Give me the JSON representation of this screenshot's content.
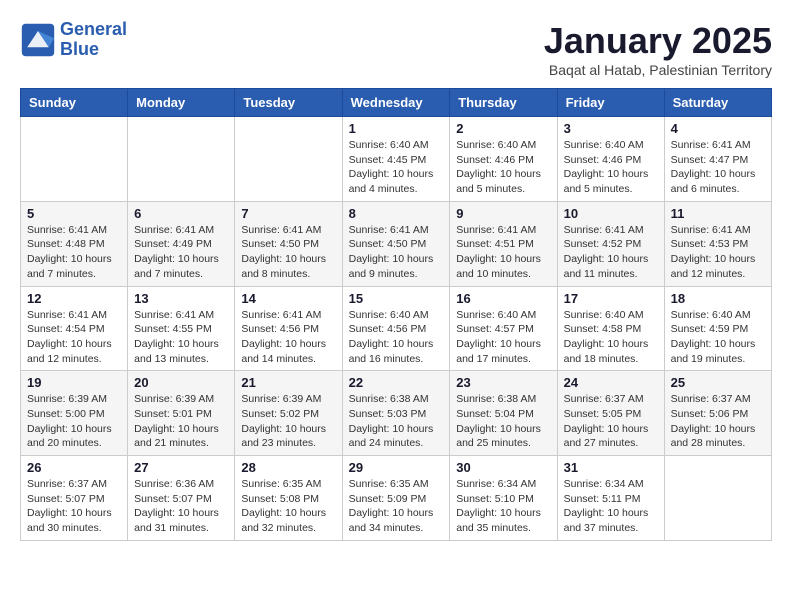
{
  "logo": {
    "line1": "General",
    "line2": "Blue"
  },
  "title": "January 2025",
  "location": "Baqat al Hatab, Palestinian Territory",
  "weekdays": [
    "Sunday",
    "Monday",
    "Tuesday",
    "Wednesday",
    "Thursday",
    "Friday",
    "Saturday"
  ],
  "weeks": [
    [
      {
        "day": "",
        "info": ""
      },
      {
        "day": "",
        "info": ""
      },
      {
        "day": "",
        "info": ""
      },
      {
        "day": "1",
        "info": "Sunrise: 6:40 AM\nSunset: 4:45 PM\nDaylight: 10 hours\nand 4 minutes."
      },
      {
        "day": "2",
        "info": "Sunrise: 6:40 AM\nSunset: 4:46 PM\nDaylight: 10 hours\nand 5 minutes."
      },
      {
        "day": "3",
        "info": "Sunrise: 6:40 AM\nSunset: 4:46 PM\nDaylight: 10 hours\nand 5 minutes."
      },
      {
        "day": "4",
        "info": "Sunrise: 6:41 AM\nSunset: 4:47 PM\nDaylight: 10 hours\nand 6 minutes."
      }
    ],
    [
      {
        "day": "5",
        "info": "Sunrise: 6:41 AM\nSunset: 4:48 PM\nDaylight: 10 hours\nand 7 minutes."
      },
      {
        "day": "6",
        "info": "Sunrise: 6:41 AM\nSunset: 4:49 PM\nDaylight: 10 hours\nand 7 minutes."
      },
      {
        "day": "7",
        "info": "Sunrise: 6:41 AM\nSunset: 4:50 PM\nDaylight: 10 hours\nand 8 minutes."
      },
      {
        "day": "8",
        "info": "Sunrise: 6:41 AM\nSunset: 4:50 PM\nDaylight: 10 hours\nand 9 minutes."
      },
      {
        "day": "9",
        "info": "Sunrise: 6:41 AM\nSunset: 4:51 PM\nDaylight: 10 hours\nand 10 minutes."
      },
      {
        "day": "10",
        "info": "Sunrise: 6:41 AM\nSunset: 4:52 PM\nDaylight: 10 hours\nand 11 minutes."
      },
      {
        "day": "11",
        "info": "Sunrise: 6:41 AM\nSunset: 4:53 PM\nDaylight: 10 hours\nand 12 minutes."
      }
    ],
    [
      {
        "day": "12",
        "info": "Sunrise: 6:41 AM\nSunset: 4:54 PM\nDaylight: 10 hours\nand 12 minutes."
      },
      {
        "day": "13",
        "info": "Sunrise: 6:41 AM\nSunset: 4:55 PM\nDaylight: 10 hours\nand 13 minutes."
      },
      {
        "day": "14",
        "info": "Sunrise: 6:41 AM\nSunset: 4:56 PM\nDaylight: 10 hours\nand 14 minutes."
      },
      {
        "day": "15",
        "info": "Sunrise: 6:40 AM\nSunset: 4:56 PM\nDaylight: 10 hours\nand 16 minutes."
      },
      {
        "day": "16",
        "info": "Sunrise: 6:40 AM\nSunset: 4:57 PM\nDaylight: 10 hours\nand 17 minutes."
      },
      {
        "day": "17",
        "info": "Sunrise: 6:40 AM\nSunset: 4:58 PM\nDaylight: 10 hours\nand 18 minutes."
      },
      {
        "day": "18",
        "info": "Sunrise: 6:40 AM\nSunset: 4:59 PM\nDaylight: 10 hours\nand 19 minutes."
      }
    ],
    [
      {
        "day": "19",
        "info": "Sunrise: 6:39 AM\nSunset: 5:00 PM\nDaylight: 10 hours\nand 20 minutes."
      },
      {
        "day": "20",
        "info": "Sunrise: 6:39 AM\nSunset: 5:01 PM\nDaylight: 10 hours\nand 21 minutes."
      },
      {
        "day": "21",
        "info": "Sunrise: 6:39 AM\nSunset: 5:02 PM\nDaylight: 10 hours\nand 23 minutes."
      },
      {
        "day": "22",
        "info": "Sunrise: 6:38 AM\nSunset: 5:03 PM\nDaylight: 10 hours\nand 24 minutes."
      },
      {
        "day": "23",
        "info": "Sunrise: 6:38 AM\nSunset: 5:04 PM\nDaylight: 10 hours\nand 25 minutes."
      },
      {
        "day": "24",
        "info": "Sunrise: 6:37 AM\nSunset: 5:05 PM\nDaylight: 10 hours\nand 27 minutes."
      },
      {
        "day": "25",
        "info": "Sunrise: 6:37 AM\nSunset: 5:06 PM\nDaylight: 10 hours\nand 28 minutes."
      }
    ],
    [
      {
        "day": "26",
        "info": "Sunrise: 6:37 AM\nSunset: 5:07 PM\nDaylight: 10 hours\nand 30 minutes."
      },
      {
        "day": "27",
        "info": "Sunrise: 6:36 AM\nSunset: 5:07 PM\nDaylight: 10 hours\nand 31 minutes."
      },
      {
        "day": "28",
        "info": "Sunrise: 6:35 AM\nSunset: 5:08 PM\nDaylight: 10 hours\nand 32 minutes."
      },
      {
        "day": "29",
        "info": "Sunrise: 6:35 AM\nSunset: 5:09 PM\nDaylight: 10 hours\nand 34 minutes."
      },
      {
        "day": "30",
        "info": "Sunrise: 6:34 AM\nSunset: 5:10 PM\nDaylight: 10 hours\nand 35 minutes."
      },
      {
        "day": "31",
        "info": "Sunrise: 6:34 AM\nSunset: 5:11 PM\nDaylight: 10 hours\nand 37 minutes."
      },
      {
        "day": "",
        "info": ""
      }
    ]
  ]
}
